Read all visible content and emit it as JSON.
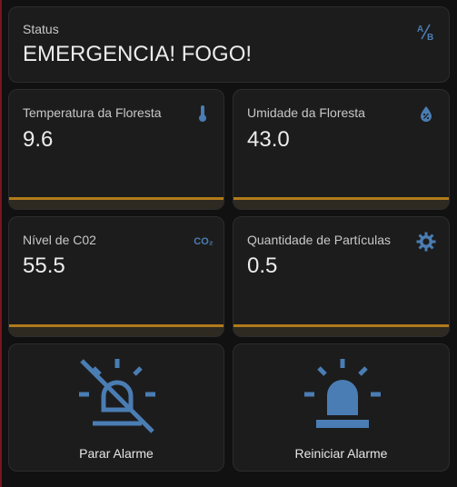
{
  "colors": {
    "accent": "#4a7db3",
    "bar": "#b07a1a",
    "card_bg": "#1c1c1c"
  },
  "status_card": {
    "label": "Status",
    "value": "EMERGENCIA! FOGO!",
    "icon": "ab-text-icon"
  },
  "sensors": [
    {
      "label": "Temperatura da Floresta",
      "value": "9.6",
      "icon": "thermometer-icon",
      "bar_fraction": 1.0
    },
    {
      "label": "Umidade da Floresta",
      "value": "43.0",
      "icon": "water-percent-icon",
      "bar_fraction": 1.0
    },
    {
      "label": "Nível de C02",
      "value": "55.5",
      "icon": "co2-icon",
      "icon_text": "CO₂",
      "bar_fraction": 1.0
    },
    {
      "label": "Quantidade de Partículas",
      "value": "0.5",
      "icon": "gear-icon",
      "bar_fraction": 1.0
    }
  ],
  "buttons": [
    {
      "label": "Parar Alarme",
      "icon": "alarm-light-off-icon"
    },
    {
      "label": "Reiniciar Alarme",
      "icon": "alarm-light-icon"
    }
  ]
}
